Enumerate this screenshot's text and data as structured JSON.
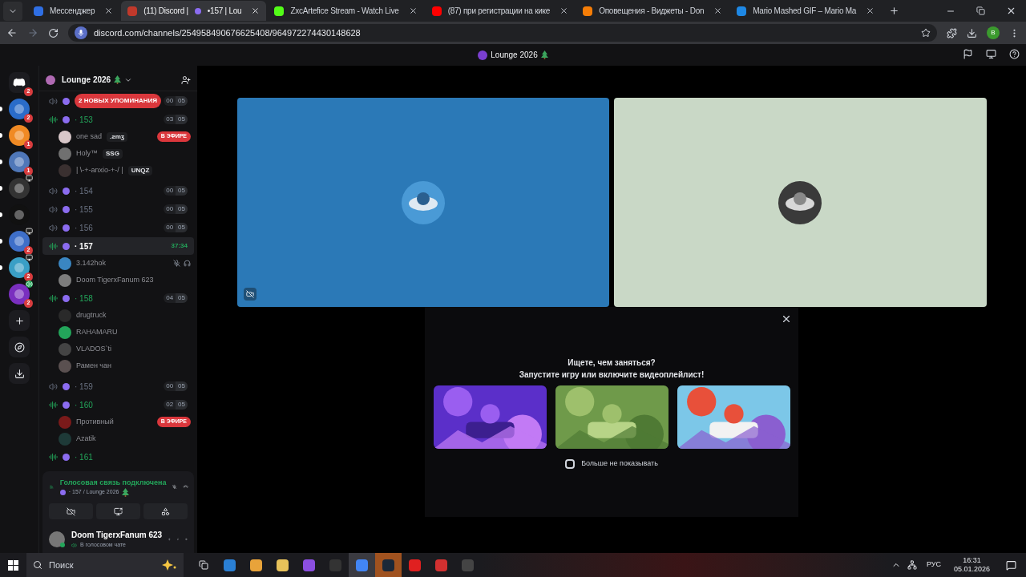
{
  "browser": {
    "tabs": [
      {
        "title": "Мессенджер",
        "selected": false
      },
      {
        "title": "(11) Discord |",
        "title_suffix": "•157 | Lou",
        "selected": true
      },
      {
        "title": "ZxcArtefice Stream - Watch Live",
        "selected": false
      },
      {
        "title": "(87) при регистрации на кике",
        "selected": false
      },
      {
        "title": "Оповещения - Виджеты - Don",
        "selected": false
      },
      {
        "title": "Mario Mashed GIF – Mario Ma",
        "selected": false
      }
    ],
    "url": "discord.com/channels/254958490676625408/964972274430148628",
    "profile": "B"
  },
  "discord": {
    "title": "Lounge 2026",
    "rail": [
      {
        "kind": "home",
        "badge": "2",
        "unread": false,
        "screen": false
      },
      {
        "kind": "server",
        "badge": "2",
        "unread": true,
        "screen": false
      },
      {
        "kind": "server",
        "badge": "1",
        "unread": true,
        "screen": false
      },
      {
        "kind": "server",
        "badge": "1",
        "unread": true,
        "screen": false
      },
      {
        "kind": "server",
        "unread": true,
        "screen": true
      },
      {
        "kind": "server",
        "unread": true,
        "screen": false
      },
      {
        "kind": "server",
        "badge": "2",
        "unread": true,
        "screen": true
      },
      {
        "kind": "server",
        "badge": "2",
        "unread": true,
        "screen": true
      },
      {
        "kind": "server",
        "badge": "2",
        "unread": false,
        "screen": false,
        "voice": true
      },
      {
        "kind": "add"
      },
      {
        "kind": "discover"
      },
      {
        "kind": "download"
      }
    ],
    "server_name": "Lounge 2026",
    "mention_pill": "2 НОВЫХ УПОМИНАНИЯ",
    "channels": [
      {
        "active": false,
        "selected": false,
        "count": "00",
        "limit": "05"
      },
      {
        "name": "· 153",
        "active": true,
        "selected": false,
        "count": "03",
        "limit": "05",
        "members": [
          {
            "name": "one sad",
            "tag": ".ƨmʒ",
            "badge": "В ЭФИРЕ"
          },
          {
            "name": "Holy™",
            "tag": "SSG"
          },
          {
            "name": "| \\-+-anxio-+-/ |",
            "tag": "UNQZ"
          }
        ]
      },
      {
        "name": "· 154",
        "active": false,
        "selected": false,
        "count": "00",
        "limit": "05"
      },
      {
        "name": "· 155",
        "active": false,
        "selected": false,
        "count": "00",
        "limit": "05"
      },
      {
        "name": "· 156",
        "active": false,
        "selected": false,
        "count": "00",
        "limit": "05"
      },
      {
        "name": "· 157",
        "active": true,
        "selected": true,
        "time": "37:34",
        "members": [
          {
            "name": "3.142hok",
            "muted": true
          },
          {
            "name": "Doom TigerxFanum 623"
          }
        ]
      },
      {
        "name": "· 158",
        "active": true,
        "selected": false,
        "count": "04",
        "limit": "05",
        "members": [
          {
            "name": "drugtruck"
          },
          {
            "name": "RAHAMARU"
          },
          {
            "name": "VLADOS`ti"
          },
          {
            "name": "Рамен чан"
          }
        ]
      },
      {
        "name": "· 159",
        "active": false,
        "selected": false,
        "count": "00",
        "limit": "05"
      },
      {
        "name": "· 160",
        "active": true,
        "selected": false,
        "count": "02",
        "limit": "05",
        "members": [
          {
            "name": "Противный",
            "badge": "В ЭФИРЕ"
          },
          {
            "name": "Azatik"
          }
        ]
      },
      {
        "name": "· 161",
        "active": true,
        "selected": false
      }
    ],
    "voice": {
      "status": "Голосовая связь подключена",
      "location": "· 157 / Lounge 2026"
    },
    "user": {
      "name": "Doom TigerxFanum 623",
      "status": "В голосовом чате"
    },
    "tiles": [
      {
        "color": "#2b79b7",
        "muted_video": true
      },
      {
        "color": "#c9d8c6",
        "muted_video": false
      }
    ],
    "prompt": {
      "title": "Ищете, чем заняться?",
      "subtitle": "Запустите игру или включите видеоплейлист!",
      "dont_show": {
        "label": "Больше не показывать",
        "checked": false
      }
    }
  },
  "taskbar": {
    "search": "Поиск",
    "language": "РУС",
    "time": "16:31",
    "date": "05.01.2026"
  }
}
